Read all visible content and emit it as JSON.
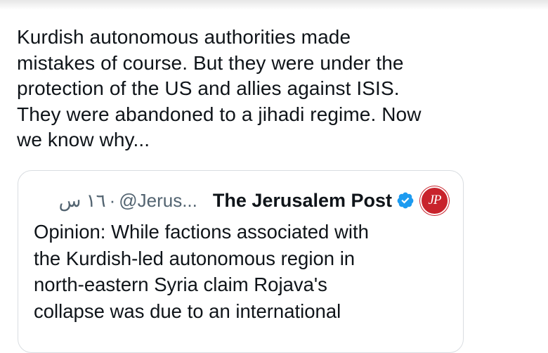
{
  "tweet": {
    "text": "Kurdish autonomous authorities made\nmistakes of course. But they were under the\nprotection of the US and allies against ISIS.\nThey were abandoned to a jihadi regime. Now\nwe know why..."
  },
  "quoted_tweet": {
    "display_name": "The Jerusalem Post",
    "handle": "@Jerus...",
    "separator": "·",
    "timestamp": "١٦ س",
    "verified_icon": "verified-badge-icon",
    "avatar_text": "JP",
    "avatar_color": "#c8232c",
    "text": "Opinion: While factions associated with\nthe Kurdish-led autonomous region in\nnorth-eastern Syria claim Rojava's\ncollapse was due to an international"
  },
  "colors": {
    "text": "#0f1419",
    "secondary_text": "#536471",
    "verified_blue": "#1d9bf0",
    "card_border": "#d9dde1"
  }
}
